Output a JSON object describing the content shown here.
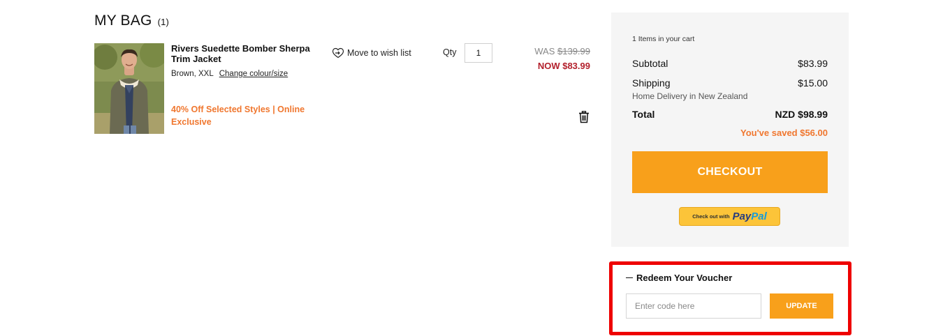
{
  "bag": {
    "title": "MY BAG",
    "count": "(1)"
  },
  "item": {
    "name": "Rivers Suedette Bomber Sherpa Trim Jacket",
    "variant": "Brown, XXL",
    "change_link": "Change colour/size",
    "promo": "40% Off Selected Styles | Online Exclusive",
    "wishlist_label": "Move to wish list",
    "qty_label": "Qty",
    "qty_value": "1",
    "was_label": "WAS",
    "was_price": "$139.99",
    "now_label": "NOW $83.99"
  },
  "summary": {
    "items_count": "1 Items in your cart",
    "subtotal_label": "Subtotal",
    "subtotal_value": "$83.99",
    "shipping_label": "Shipping",
    "shipping_value": "$15.00",
    "shipping_note": "Home Delivery in New Zealand",
    "total_label": "Total",
    "total_value": "NZD $98.99",
    "saved": "You've saved $56.00",
    "checkout_label": "CHECKOUT",
    "paypal_prefix": "Check out with",
    "paypal_pay": "Pay",
    "paypal_pal": "Pal"
  },
  "voucher": {
    "title": "Redeem Your Voucher",
    "placeholder": "Enter code here",
    "value": "",
    "update_label": "UPDATE"
  },
  "colors": {
    "accent_orange": "#f8a01b",
    "promo_orange": "#f0772f",
    "sale_red": "#b3202c",
    "highlight_red": "#ee0000",
    "summary_bg": "#f5f5f5"
  },
  "icons": {
    "wishlist": "heart-arrow-icon",
    "delete": "trash-icon",
    "voucher_toggle": "minus-icon"
  }
}
